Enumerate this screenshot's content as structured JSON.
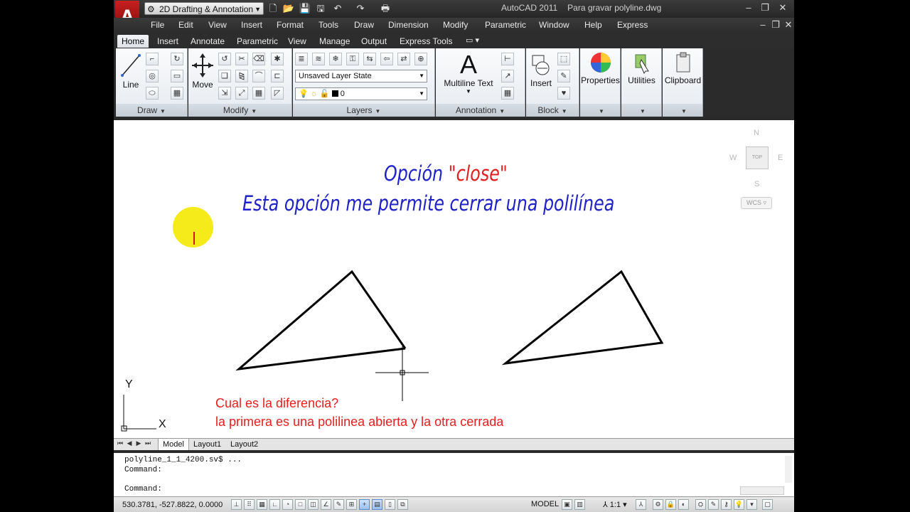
{
  "app": {
    "logo_letter": "A",
    "workspace": "2D Drafting & Annotation",
    "window_title": "AutoCAD 2011",
    "file_name": "Para gravar polyline.dwg"
  },
  "menu": [
    "File",
    "Edit",
    "View",
    "Insert",
    "Format",
    "Tools",
    "Draw",
    "Dimension",
    "Modify",
    "Parametric",
    "Window",
    "Help",
    "Express"
  ],
  "ribbon_tabs": [
    "Home",
    "Insert",
    "Annotate",
    "Parametric",
    "View",
    "Manage",
    "Output",
    "Express Tools"
  ],
  "ribbon": {
    "draw": {
      "title": "Draw",
      "line_label": "Line"
    },
    "modify": {
      "title": "Modify",
      "move_label": "Move"
    },
    "layers": {
      "title": "Layers",
      "layer_state": "Unsaved Layer State",
      "current_layer": "0"
    },
    "annotation": {
      "title": "Annotation",
      "multiline_glyph": "A",
      "multiline_label": "Multiline Text"
    },
    "block": {
      "title": "Block",
      "insert_label": "Insert"
    },
    "properties_label": "Properties",
    "utilities_label": "Utilities",
    "clipboard_label": "Clipboard"
  },
  "drawing": {
    "title_prefix": "Opción ",
    "title_keyword": "\"close\"",
    "subtitle": "Esta opción me permite cerrar una polilínea",
    "question": "Cual es la diferencia?",
    "answer": "la primera es una polilinea abierta y la otra cerrada",
    "viewcube": {
      "n": "N",
      "s": "S",
      "e": "E",
      "w": "W",
      "top": "TOP",
      "wcs": "WCS"
    },
    "ucs_x": "X",
    "ucs_y": "Y"
  },
  "layout_tabs": [
    "Model",
    "Layout1",
    "Layout2"
  ],
  "command": {
    "history1": "polyline_1_1_4200.sv$ ...",
    "history2": "Command:",
    "prompt": "Command:"
  },
  "status": {
    "coordinates": "530.3781, -527.8822, 0.0000",
    "model": "MODEL",
    "annotation_scale": "1:1"
  },
  "colors": {
    "title_blue": "#1e22c8",
    "keyword_red": "#e01e1e",
    "note_red": "#e81e1e",
    "highlight_yellow": "#f5ea1a"
  }
}
